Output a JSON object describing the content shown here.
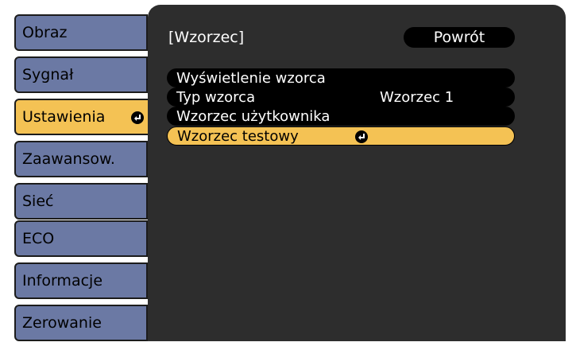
{
  "sidebar": {
    "items": [
      {
        "label": "Obraz"
      },
      {
        "label": "Sygnał"
      },
      {
        "label": "Ustawienia"
      },
      {
        "label": "Zaawansow."
      },
      {
        "label": "Sieć"
      },
      {
        "label": "ECO"
      },
      {
        "label": "Informacje"
      },
      {
        "label": "Zerowanie"
      }
    ],
    "active_index": 2
  },
  "panel": {
    "title": "[Wzorzec]",
    "back_label": "Powrót",
    "rows": [
      {
        "label": "Wyświetlenie wzorca",
        "value": ""
      },
      {
        "label": "Typ wzorca",
        "value": "Wzorzec 1"
      },
      {
        "label": "Wzorzec użytkownika",
        "value": ""
      },
      {
        "label": "Wzorzec testowy",
        "value": ""
      }
    ],
    "selected_index": 3
  },
  "colors": {
    "tab": "#6b79a4",
    "active": "#f4c254",
    "panel": "#2d2d2d"
  },
  "icons": {
    "enter": "enter-icon"
  }
}
